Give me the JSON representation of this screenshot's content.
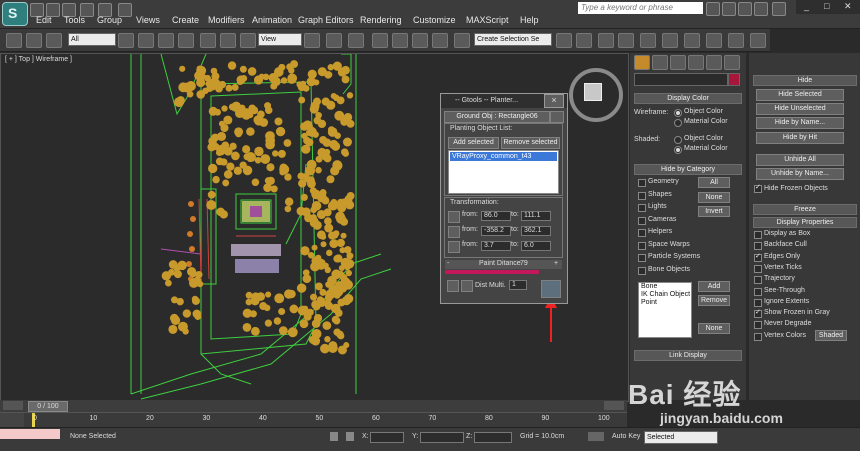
{
  "menu": {
    "logo_letter": "S",
    "items": [
      "Edit",
      "Tools",
      "Group",
      "Views",
      "Create",
      "Modifiers",
      "Animation",
      "Graph Editors",
      "Rendering",
      "Customize",
      "MAXScript",
      "Help"
    ],
    "search_placeholder": "Type a keyword or phrase"
  },
  "toolbar": {
    "selection_filter": "All",
    "ref_coord": "View",
    "named_selection": "Create Selection Se"
  },
  "viewport": {
    "label": "[ + ] Top ] Wireframe ]",
    "colors": {
      "wire": "#3fcf3f",
      "tree": "#c89a2c",
      "bg": "#2b2b2b"
    }
  },
  "gtools": {
    "title": "-- Gtools -- Planter...",
    "ground_obj": "Ground Obj : Rectangle06",
    "list_group": "Planting Object List:",
    "add_selected": "Add selected",
    "remove_selected": "Remove selected",
    "list_item": "VRayProxy_common_t43",
    "transform_group": "Transformation:",
    "rows": [
      {
        "from_label": "from:",
        "from": "86.0",
        "to_label": "to:",
        "to": "111.1"
      },
      {
        "from_label": "from:",
        "from": "-358.2",
        "to_label": "to:",
        "to": "362.1"
      },
      {
        "from_label": "from:",
        "from": "3.7",
        "to_label": "to:",
        "to": "6.0"
      }
    ],
    "paint_distance_label": "Paint Ditance",
    "paint_distance": "79",
    "minus": "-",
    "plus": "+",
    "dist_mult_label": "Dist Multi.",
    "dist_mult": "1",
    "close": "×"
  },
  "display_panel": {
    "display_color_header": "Display Color",
    "wireframe_label": "Wireframe:",
    "shaded_label": "Shaded:",
    "object_color": "Object Color",
    "material_color": "Material Color",
    "hide_by_category_header": "Hide by Category",
    "categories": [
      "Geometry",
      "Shapes",
      "Lights",
      "Cameras",
      "Helpers",
      "Space Warps",
      "Particle Systems",
      "Bone Objects"
    ],
    "all": "All",
    "none": "None",
    "invert": "Invert",
    "list_items": [
      "Bone",
      "IK Chain Object",
      "Point"
    ],
    "add": "Add",
    "remove": "Remove",
    "none2": "None",
    "link_display": "Link Display"
  },
  "hide_panel": {
    "header": "Hide",
    "buttons": [
      "Hide Selected",
      "Hide Unselected",
      "Hide by Name...",
      "Hide by Hit",
      "Unhide All",
      "Unhide by Name..."
    ],
    "hide_frozen": "Hide Frozen Objects",
    "freeze_header": "Freeze",
    "display_props_header": "Display Properties",
    "props": [
      {
        "label": "Display as Box",
        "checked": false
      },
      {
        "label": "Backface Cull",
        "checked": false
      },
      {
        "label": "Edges Only",
        "checked": true
      },
      {
        "label": "Vertex Ticks",
        "checked": false
      },
      {
        "label": "Trajectory",
        "checked": false
      },
      {
        "label": "See-Through",
        "checked": false
      },
      {
        "label": "Ignore Extents",
        "checked": false
      },
      {
        "label": "Show Frozen in Gray",
        "checked": true
      },
      {
        "label": "Never Degrade",
        "checked": false
      },
      {
        "label": "Vertex Colors",
        "checked": false
      }
    ],
    "shaded": "Shaded"
  },
  "timeline": {
    "frame": "0 / 100",
    "ticks": [
      "0",
      "10",
      "20",
      "30",
      "40",
      "50",
      "60",
      "70",
      "80",
      "90",
      "100"
    ]
  },
  "status": {
    "selection": "None Selected",
    "x_label": "X:",
    "y_label": "Y:",
    "z_label": "Z:",
    "grid": "Grid = 10.0cm",
    "auto_key": "Auto Key",
    "key_filter": "Selected"
  },
  "watermark": {
    "brand": "Bai 经验",
    "url": "jingyan.baidu.com"
  }
}
